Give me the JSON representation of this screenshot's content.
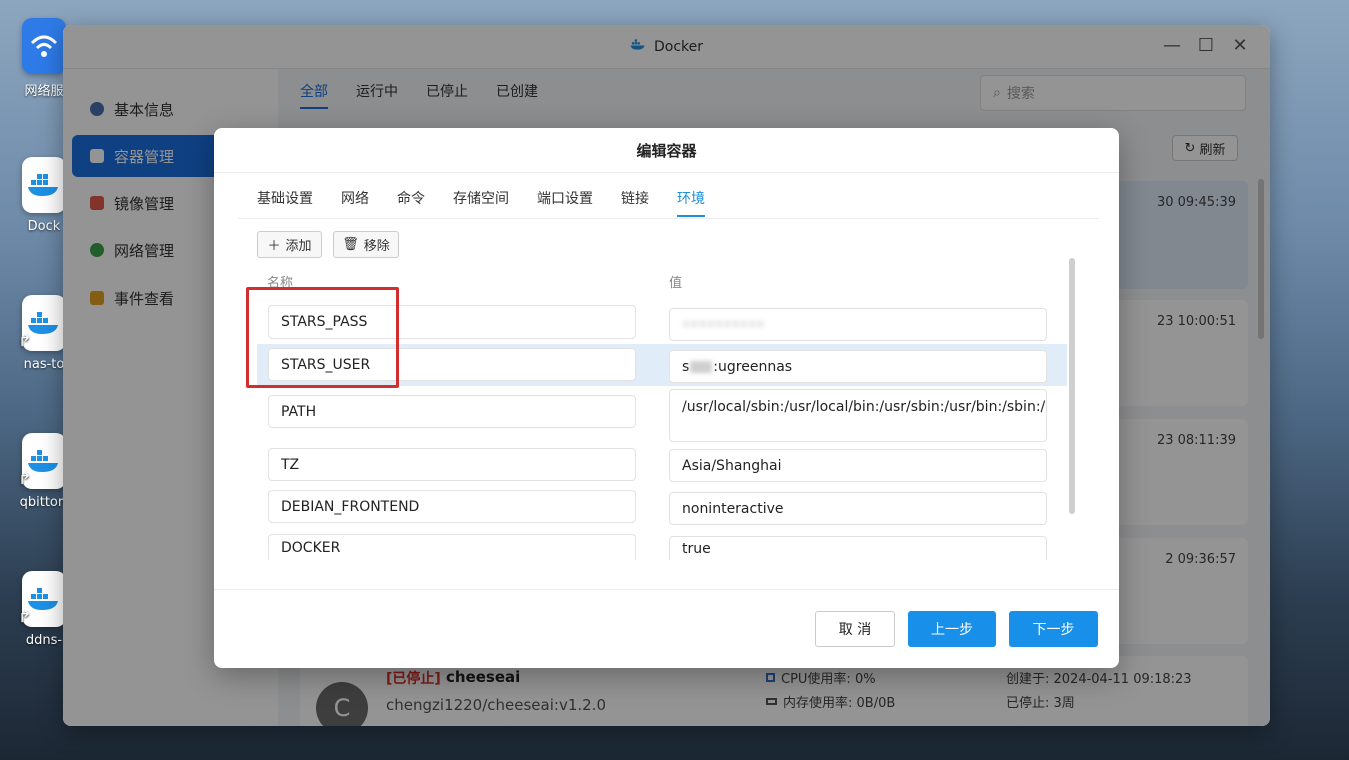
{
  "desktop": {
    "icons": [
      {
        "label": "网络服",
        "icon": "network-service-icon"
      },
      {
        "label": "Dock",
        "icon": "docker-icon"
      },
      {
        "label": "nas-to",
        "icon": "docker-icon"
      },
      {
        "label": "qbittorr",
        "icon": "docker-icon"
      },
      {
        "label": "ddns-",
        "icon": "docker-icon"
      }
    ]
  },
  "window": {
    "title": "Docker",
    "controls": {
      "minimize": "—",
      "maximize": "☐",
      "close": "✕"
    }
  },
  "sidebar": {
    "items": [
      {
        "label": "基本信息",
        "icon": "info-icon",
        "color": "#4a6fb0"
      },
      {
        "label": "容器管理",
        "icon": "container-icon",
        "color": "#ffffff"
      },
      {
        "label": "镜像管理",
        "icon": "image-icon",
        "color": "#e05a4a"
      },
      {
        "label": "网络管理",
        "icon": "network-icon",
        "color": "#3aa24a"
      },
      {
        "label": "事件查看",
        "icon": "event-icon",
        "color": "#e0a020"
      }
    ]
  },
  "main": {
    "tabs": [
      "全部",
      "运行中",
      "已停止",
      "已创建"
    ],
    "search_placeholder": "搜索",
    "refresh_label": "刷新",
    "container_times": [
      "30 09:45:39",
      "23 10:00:51",
      "23 08:11:39",
      "2 09:36:57"
    ],
    "bottom_card": {
      "status": "[已停止]",
      "name": "cheeseai",
      "image": "chengzi1220/cheeseai:v1.2.0",
      "avatar": "C",
      "cpu": "CPU使用率: 0%",
      "mem": "内存使用率: 0B/0B",
      "created": "创建于: 2024-04-11 09:18:23",
      "stopped": "已停止: 3周"
    }
  },
  "dialog": {
    "title": "编辑容器",
    "tabs": [
      "基础设置",
      "网络",
      "命令",
      "存储空间",
      "端口设置",
      "链接",
      "环境"
    ],
    "active_tab": "环境",
    "add_label": "添加",
    "remove_label": "移除",
    "col_name": "名称",
    "col_value": "值",
    "env": [
      {
        "name": "STARS_PASS",
        "value": "••••••••••"
      },
      {
        "name": "STARS_USER",
        "value_prefix": "s",
        "value_suffix": ":ugreennas"
      },
      {
        "name": "PATH",
        "value": "/usr/local/sbin:/usr/local/bin:/usr/sbin:/usr/bin:/sbin:/bin"
      },
      {
        "name": "TZ",
        "value": "Asia/Shanghai"
      },
      {
        "name": "DEBIAN_FRONTEND",
        "value": "noninteractive"
      },
      {
        "name": "DOCKER",
        "value": "true"
      }
    ],
    "cancel_label": "取 消",
    "prev_label": "上一步",
    "next_label": "下一步"
  },
  "colors": {
    "accent": "#1b6fe0",
    "primary_button": "#1890ea",
    "highlight_box": "#d32e2e",
    "selected_row": "#e1ecf9"
  }
}
